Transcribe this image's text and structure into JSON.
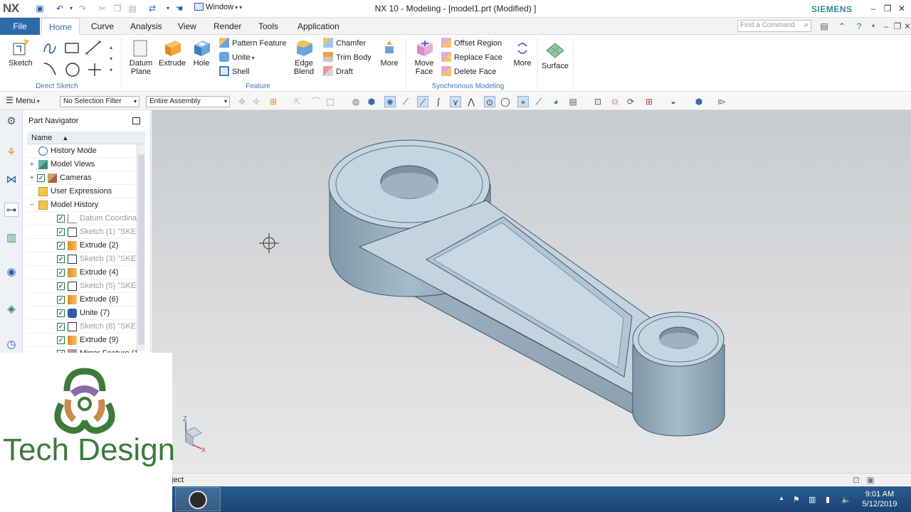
{
  "window": {
    "app_logo": "NX",
    "title": "NX 10 - Modeling - [model1.prt (Modified) ]",
    "window_menu": "Window",
    "brand": "SIEMENS"
  },
  "ribbon_tabs": {
    "file": "File",
    "tabs": [
      "Home",
      "Curve",
      "Analysis",
      "View",
      "Render",
      "Tools",
      "Application"
    ],
    "active_tab": "Home",
    "find_placeholder": "Find a Command"
  },
  "ribbon": {
    "direct_sketch": {
      "label": "Direct Sketch",
      "sketch": "Sketch"
    },
    "feature": {
      "label": "Feature",
      "datum_plane": "Datum Plane",
      "extrude": "Extrude",
      "hole": "Hole",
      "pattern_feature": "Pattern Feature",
      "unite": "Unite",
      "shell": "Shell",
      "edge_blend": "Edge Blend",
      "chamfer": "Chamfer",
      "trim_body": "Trim Body",
      "draft": "Draft",
      "more": "More"
    },
    "synchronous": {
      "label": "Synchronous Modeling",
      "move_face": "Move Face",
      "offset_region": "Offset Region",
      "replace_face": "Replace Face",
      "delete_face": "Delete Face",
      "more": "More"
    },
    "surface": {
      "label": "Surface"
    }
  },
  "toolbar": {
    "menu": "Menu",
    "selection_filter": "No Selection Filter",
    "assembly_scope": "Entire Assembly"
  },
  "navigator": {
    "title": "Part Navigator",
    "column_name": "Name",
    "items": [
      {
        "label": "History Mode",
        "icon": "clock-icon",
        "checked": false,
        "dim": false,
        "expander": ""
      },
      {
        "label": "Model Views",
        "icon": "cube-icon",
        "checked": false,
        "dim": false,
        "expander": "+"
      },
      {
        "label": "Cameras",
        "icon": "camera-icon",
        "checked": true,
        "dim": false,
        "expander": "+"
      },
      {
        "label": "User Expressions",
        "icon": "folder-icon",
        "checked": false,
        "dim": false,
        "expander": ""
      },
      {
        "label": "Model History",
        "icon": "folder-icon",
        "checked": false,
        "dim": false,
        "expander": "−"
      },
      {
        "label": "Datum Coordina",
        "icon": "datum-icon",
        "checked": true,
        "dim": true,
        "expander": ""
      },
      {
        "label": "Sketch (1) \"SKET",
        "icon": "sketch-icon",
        "checked": true,
        "dim": true,
        "expander": ""
      },
      {
        "label": "Extrude (2)",
        "icon": "extrude-icon",
        "checked": true,
        "dim": false,
        "expander": ""
      },
      {
        "label": "Sketch (3) \"SKET",
        "icon": "sketch-icon",
        "checked": true,
        "dim": true,
        "expander": ""
      },
      {
        "label": "Extrude (4)",
        "icon": "extrude-icon",
        "checked": true,
        "dim": false,
        "expander": ""
      },
      {
        "label": "Sketch (5) \"SKET",
        "icon": "sketch-icon",
        "checked": true,
        "dim": true,
        "expander": ""
      },
      {
        "label": "Extrude (6)",
        "icon": "extrude-icon",
        "checked": true,
        "dim": false,
        "expander": ""
      },
      {
        "label": "Unite (7)",
        "icon": "unite-icon",
        "checked": true,
        "dim": false,
        "expander": ""
      },
      {
        "label": "Sketch (8) \"SKET",
        "icon": "sketch-icon",
        "checked": true,
        "dim": true,
        "expander": ""
      },
      {
        "label": "Extrude (9)",
        "icon": "extrude-icon",
        "checked": true,
        "dim": false,
        "expander": ""
      },
      {
        "label": "Mirror Feature (1",
        "icon": "mirror-icon",
        "checked": true,
        "dim": false,
        "expander": ""
      }
    ]
  },
  "graphics": {
    "triad_z": "Z",
    "triad_x": "X"
  },
  "status": {
    "text": "ject"
  },
  "taskbar": {
    "time": "9:01 AM",
    "date": "5/12/2019"
  },
  "watermark": {
    "text": "Tech Design"
  },
  "colors": {
    "accent": "#2d6aa8",
    "part_fill": "#a9c2d2",
    "brand_green": "#3d7a3a"
  }
}
